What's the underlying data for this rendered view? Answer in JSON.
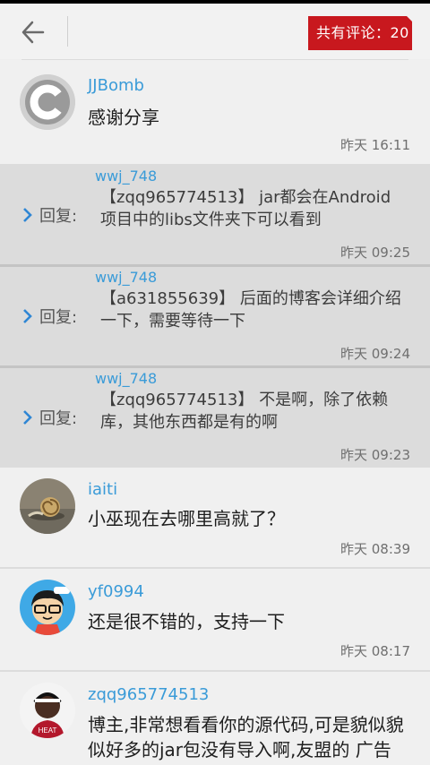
{
  "header": {
    "comment_count_label": "共有评论：20"
  },
  "comments": [
    {
      "user": "JJBomb",
      "text": "感谢分享",
      "time": "昨天 16:11",
      "avatar_icon": "c-logo-avatar"
    },
    {
      "user": "iaiti",
      "text": "小巫现在去哪里高就了？",
      "time": "昨天 08:39",
      "avatar_icon": "snail-photo-avatar"
    },
    {
      "user": "yf0994",
      "text": "还是很不错的，支持一下",
      "time": "昨天 08:17",
      "avatar_icon": "cartoon-boy-avatar"
    },
    {
      "user": "zqq965774513",
      "text": "博主,非常想看看你的源代码,可是貌似貌似好多的jar包没有导入啊,友盟的 广告的？有也没有 求解啊",
      "time": "",
      "avatar_icon": "basketball-player-avatar"
    }
  ],
  "replies": [
    {
      "label": "回复:",
      "user": "wwj_748",
      "text": "【zqq965774513】 jar都会在Android项目中的libs文件夹下可以看到",
      "time": "昨天 09:25"
    },
    {
      "label": "回复:",
      "user": "wwj_748",
      "text": "【a631855639】 后面的博客会详细介绍一下，需要等待一下",
      "time": "昨天 09:24"
    },
    {
      "label": "回复:",
      "user": "wwj_748",
      "text": "【zqq965774513】 不是啊，除了依赖库，其他东西都是有的啊",
      "time": "昨天 09:23"
    }
  ],
  "colors": {
    "accent_red": "#c8181e",
    "username_blue": "#3a9bd8"
  }
}
